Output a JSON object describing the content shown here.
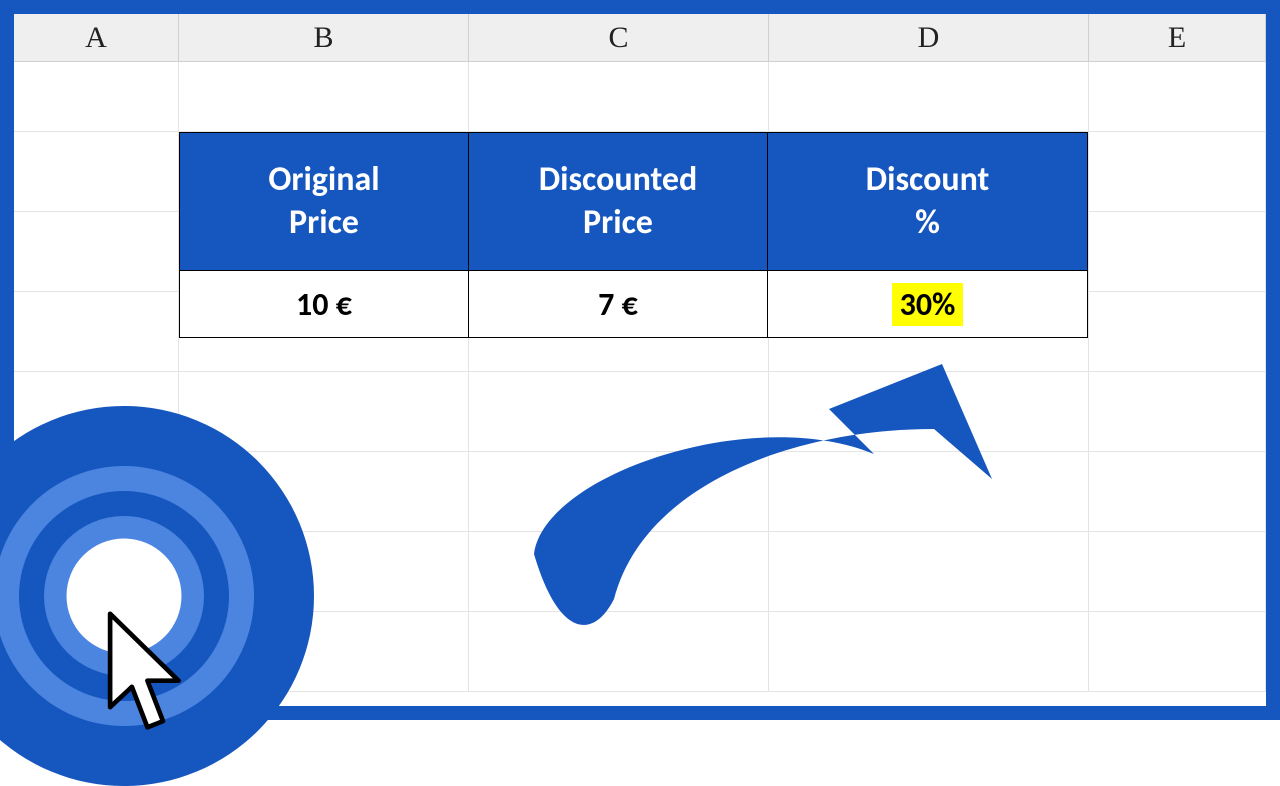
{
  "columns": {
    "A": "A",
    "B": "B",
    "C": "C",
    "D": "D",
    "E": "E"
  },
  "table": {
    "headers": {
      "B": "Original\nPrice",
      "C": "Discounted\nPrice",
      "D": "Discount\n%"
    },
    "values": {
      "B": "10 €",
      "C": "7 €",
      "D": "30%"
    }
  },
  "colors": {
    "frame": "#1656bf",
    "header_bg": "#1656bf",
    "highlight": "#ffff00",
    "arrow": "#1656bf"
  }
}
